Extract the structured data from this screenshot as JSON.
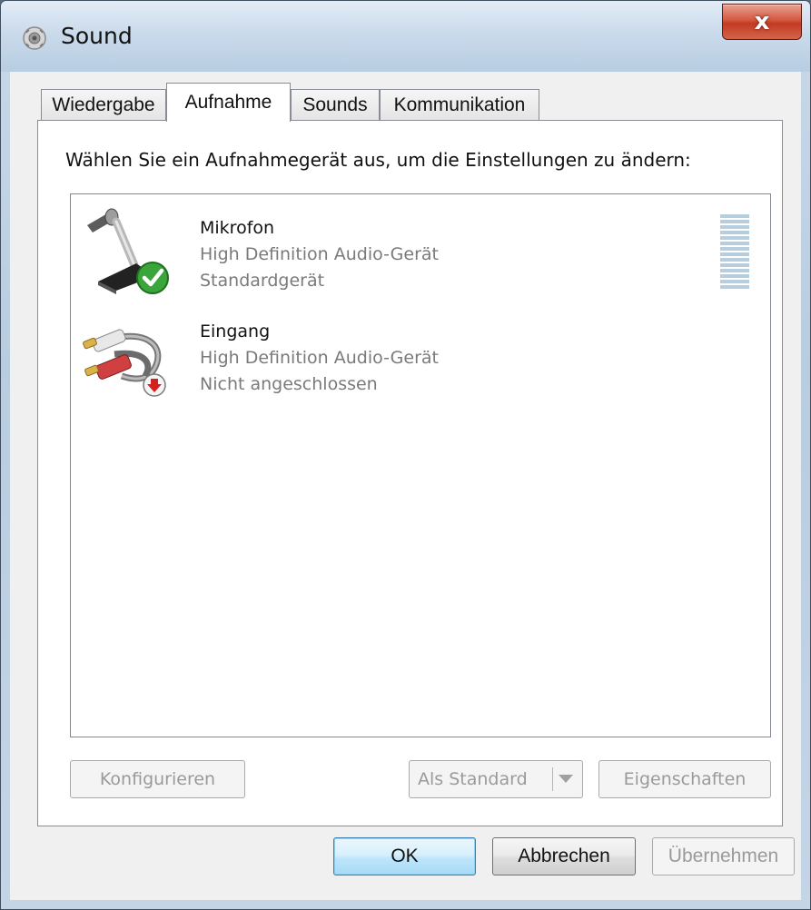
{
  "window": {
    "title": "Sound",
    "close_label": "x"
  },
  "tabs": [
    {
      "label": "Wiedergabe",
      "active": false
    },
    {
      "label": "Aufnahme",
      "active": true
    },
    {
      "label": "Sounds",
      "active": false
    },
    {
      "label": "Kommunikation",
      "active": false
    }
  ],
  "instruction": "Wählen Sie ein Aufnahmegerät aus, um die Einstellungen zu ändern:",
  "devices": [
    {
      "name": "Mikrofon",
      "driver": "High Definition Audio-Gerät",
      "status": "Standardgerät",
      "icon": "microphone-icon",
      "badge": "green-check-badge",
      "level_meter": "level-meter"
    },
    {
      "name": "Eingang",
      "driver": "High Definition Audio-Gerät",
      "status": "Nicht angeschlossen",
      "icon": "rca-cable-icon",
      "badge": "red-down-arrow-badge"
    }
  ],
  "buttons": {
    "configure": "Konfigurieren",
    "set_default": "Als Standard",
    "properties": "Eigenschaften",
    "ok": "OK",
    "cancel": "Abbrechen",
    "apply": "Übernehmen"
  },
  "colors": {
    "accent_blue": "#3c7fb1",
    "close_red": "#c23b22",
    "check_green": "#3aa53a",
    "disabled_text": "#9a9a9a",
    "secondary_text": "#7a7a7a"
  }
}
